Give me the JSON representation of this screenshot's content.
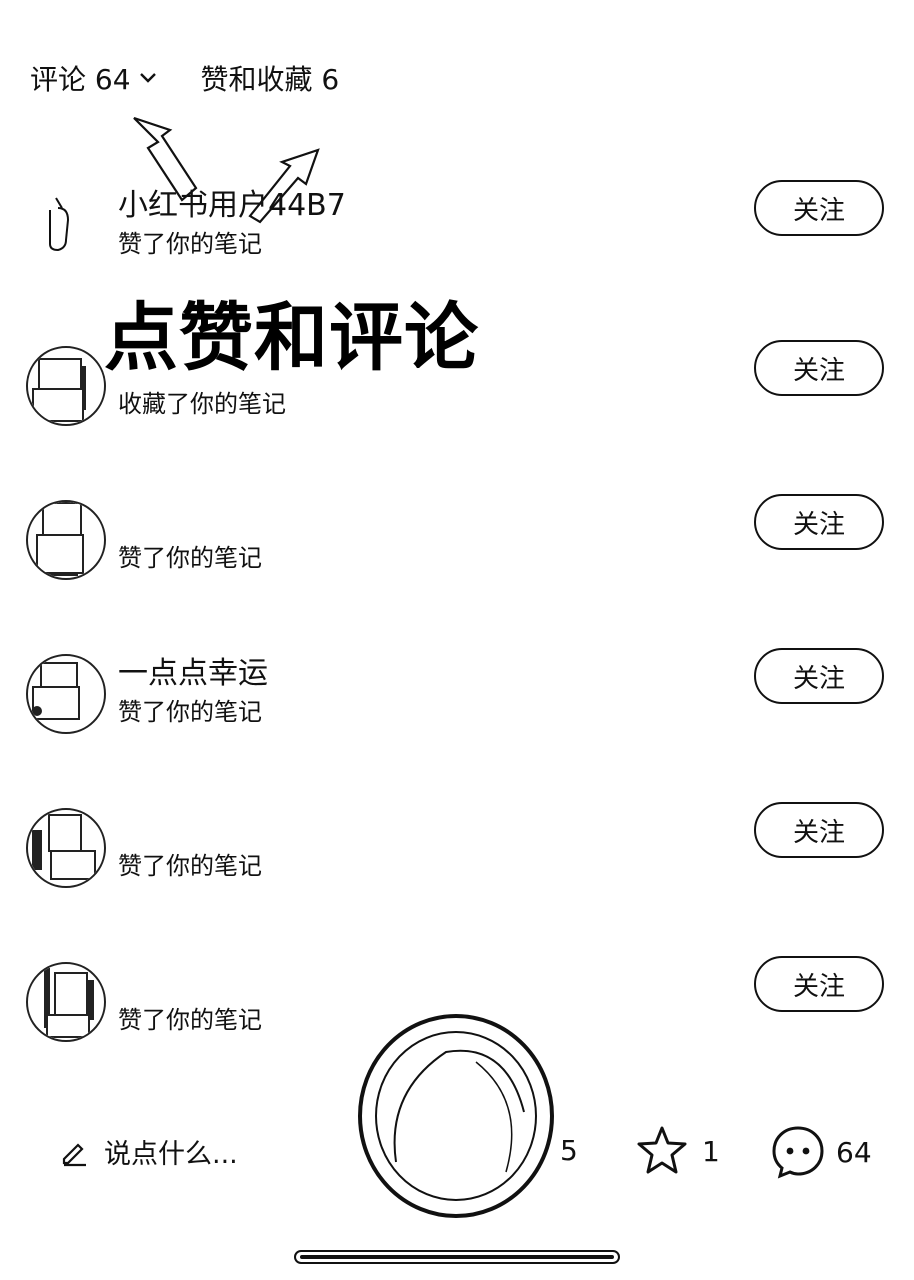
{
  "tabs": [
    {
      "label": "评论 64"
    },
    {
      "label": "赞和收藏 6"
    }
  ],
  "overlay_title": "点赞和评论",
  "follow_label": "关注",
  "rows": [
    {
      "name": "小红书用户44B7",
      "action": "赞了你的笔记"
    },
    {
      "name": "",
      "action": "收藏了你的笔记"
    },
    {
      "name": "",
      "action": "赞了你的笔记"
    },
    {
      "name": "一点点幸运",
      "action": "赞了你的笔记"
    },
    {
      "name": "",
      "action": "赞了你的笔记"
    },
    {
      "name": "",
      "action": "赞了你的笔记"
    }
  ],
  "bottom_bar": {
    "comment_placeholder": "说点什么...",
    "like_count": "5",
    "star_count": "1",
    "comment_count": "64"
  }
}
